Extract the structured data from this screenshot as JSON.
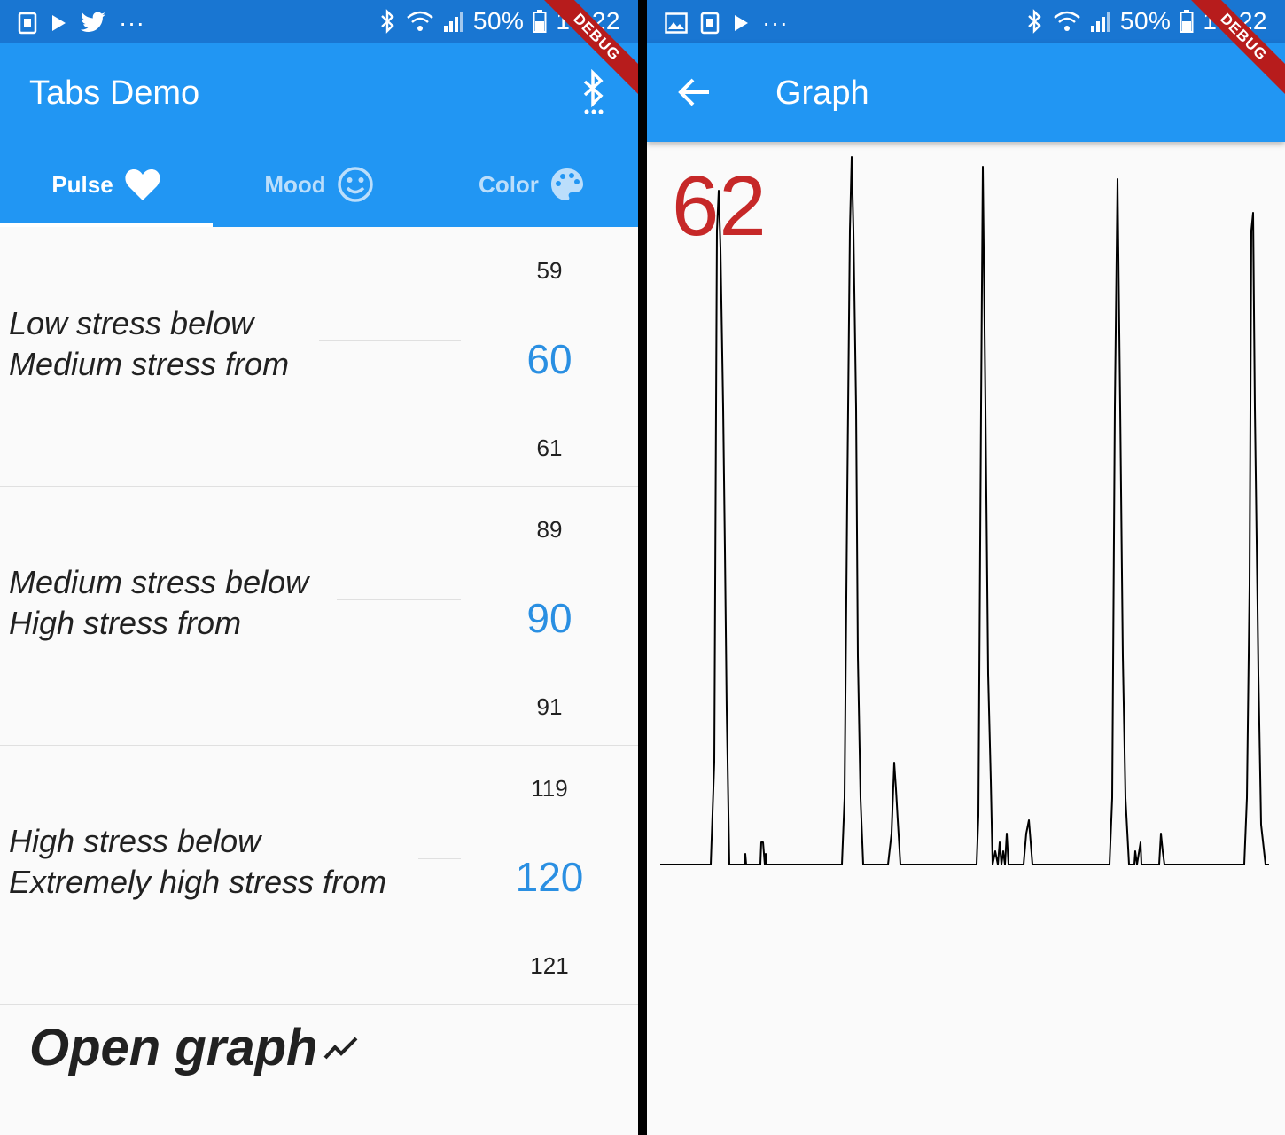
{
  "status_bar": {
    "battery": "50%",
    "time": "17:22"
  },
  "debug_banner": "DEBUG",
  "tabs_screen": {
    "title": "Tabs Demo",
    "tabs": [
      {
        "label": "Pulse",
        "icon": "heart-icon",
        "active": true
      },
      {
        "label": "Mood",
        "icon": "smiley-icon",
        "active": false
      },
      {
        "label": "Color",
        "icon": "palette-icon",
        "active": false
      }
    ],
    "thresholds": [
      {
        "line1": "Low stress below",
        "line2": "Medium stress from",
        "prev": "59",
        "value": "60",
        "next": "61"
      },
      {
        "line1": "Medium stress below",
        "line2": "High stress from",
        "prev": "89",
        "value": "90",
        "next": "91"
      },
      {
        "line1": "High stress below",
        "line2": "Extremely high stress from",
        "prev": "119",
        "value": "120",
        "next": "121"
      }
    ],
    "open_graph_label": "Open graph"
  },
  "graph_screen": {
    "title": "Graph",
    "bpm": "62",
    "colors": {
      "bpm": "#c62828",
      "line": "#000000"
    }
  },
  "colors": {
    "appbar": "#2196f3",
    "statusbar": "#1976d2",
    "picker_selected": "#2a8fe2"
  }
}
